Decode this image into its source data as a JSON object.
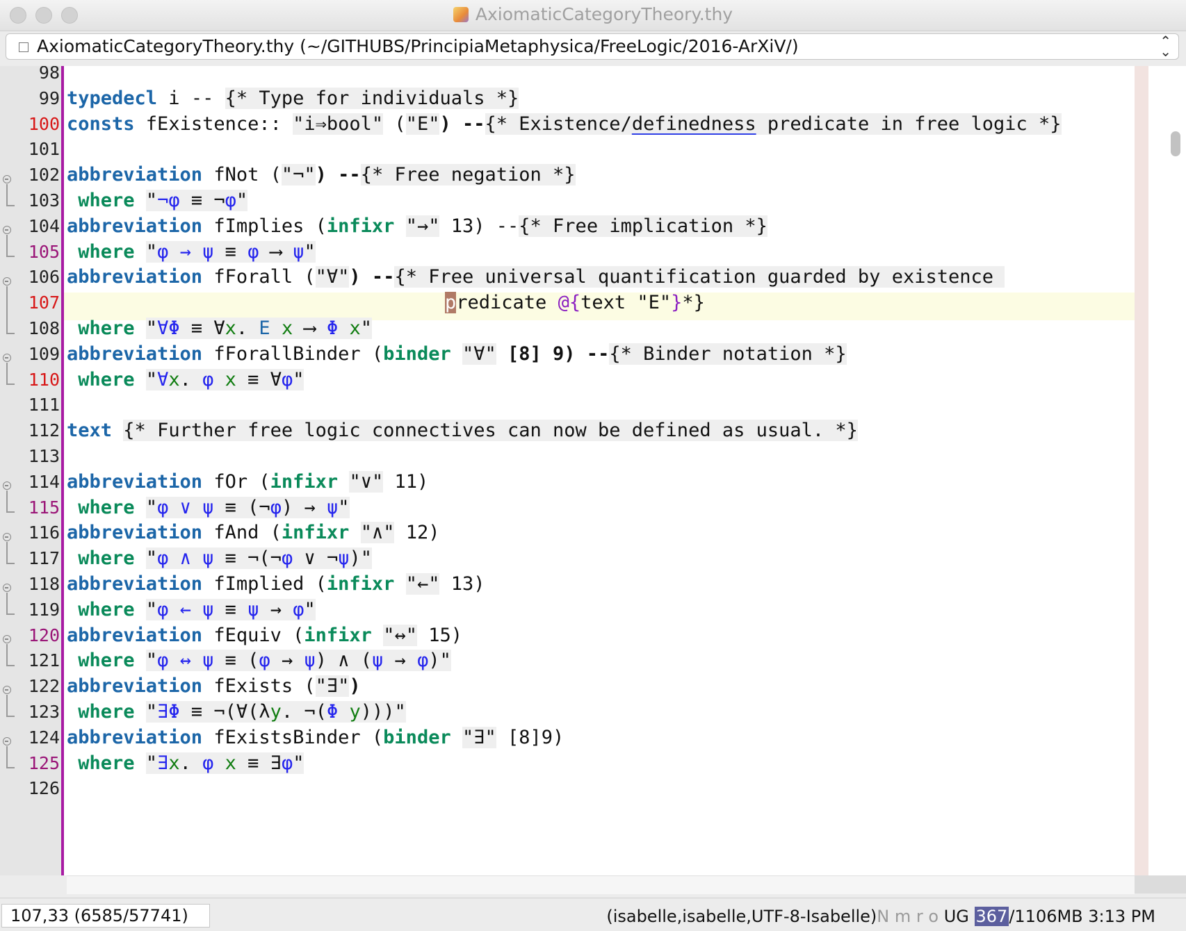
{
  "window": {
    "title": "AxiomaticCategoryTheory.thy"
  },
  "path_bar": {
    "text": "AxiomaticCategoryTheory.thy (~/GITHUBS/PrincipiaMetaphysica/FreeLogic/2016-ArXiV/)"
  },
  "line_numbers": [
    "98",
    "99",
    "100",
    "101",
    "102",
    "103",
    "104",
    "105",
    "106",
    "107",
    "108",
    "109",
    "110",
    "111",
    "112",
    "113",
    "114",
    "115",
    "116",
    "117",
    "118",
    "119",
    "120",
    "121",
    "122",
    "123",
    "124",
    "125",
    "126"
  ],
  "code": {
    "l98": [],
    "l99": [
      "typedecl",
      " i -- ",
      "{* Type for individuals *}"
    ],
    "l100": [
      "consts",
      " fExistence:: ",
      "\"i⇒bool\"",
      " (",
      "\"E\"",
      ") --",
      "{* Existence/",
      "definedness",
      " predicate in free logic *}"
    ],
    "l101": [],
    "l102": [
      "abbreviation",
      " fNot (",
      "\"¬\"",
      ") --",
      "{* Free negation *}"
    ],
    "l103": [
      " ",
      "where",
      " ",
      "\"",
      "¬",
      "φ",
      " ≡ ¬",
      "φ",
      "\""
    ],
    "l104": [
      "abbreviation",
      " fImplies (",
      "infixr",
      " ",
      "\"→\"",
      " 13) --",
      "{* Free implication *}"
    ],
    "l105": [
      " ",
      "where",
      " ",
      "\"",
      "φ",
      " ",
      "→",
      " ",
      "ψ",
      " ≡ ",
      "φ",
      " ⟶ ",
      "ψ",
      "\""
    ],
    "l106": [
      "abbreviation",
      " fForall (",
      "\"∀\"",
      ") --",
      "{* Free universal quantification guarded by existence "
    ],
    "l107": [
      "p",
      "redicate ",
      "@{",
      "text ",
      "\"E\"",
      "}",
      "*}"
    ],
    "l108": [
      " ",
      "where",
      " ",
      "\"",
      "∀",
      "Φ",
      " ≡ ∀",
      "x",
      ". ",
      "E",
      " ",
      "x",
      " ⟶ ",
      "Φ",
      " ",
      "x",
      "\""
    ],
    "l109": [
      "abbreviation",
      " fForallBinder (",
      "binder",
      " ",
      "\"∀\"",
      " [8] 9) --",
      "{* Binder notation *}"
    ],
    "l110": [
      " ",
      "where",
      " ",
      "\"",
      "∀",
      "x",
      ". ",
      "φ",
      " ",
      "x",
      " ≡ ∀",
      "φ",
      "\""
    ],
    "l111": [],
    "l112": [
      "text",
      " ",
      "{* Further free logic connectives can now be defined as usual. *}"
    ],
    "l113": [],
    "l114": [
      "abbreviation",
      " fOr (",
      "infixr",
      " ",
      "\"∨\"",
      " 11)"
    ],
    "l115": [
      " ",
      "where",
      " ",
      "\"",
      "φ",
      " ",
      "∨",
      " ",
      "ψ",
      " ≡ (¬",
      "φ",
      ") → ",
      "ψ",
      "\""
    ],
    "l116": [
      "abbreviation",
      " fAnd (",
      "infixr",
      " ",
      "\"∧\"",
      " 12)"
    ],
    "l117": [
      " ",
      "where",
      " ",
      "\"",
      "φ",
      " ",
      "∧",
      " ",
      "ψ",
      " ≡ ¬(¬",
      "φ",
      " ∨ ¬",
      "ψ",
      ")\""
    ],
    "l118": [
      "abbreviation",
      " fImplied (",
      "infixr",
      " ",
      "\"←\"",
      " 13)"
    ],
    "l119": [
      " ",
      "where",
      " ",
      "\"",
      "φ",
      " ",
      "←",
      " ",
      "ψ",
      " ≡ ",
      "ψ",
      " → ",
      "φ",
      "\""
    ],
    "l120": [
      "abbreviation",
      " fEquiv (",
      "infixr",
      " ",
      "\"↔\"",
      " 15)"
    ],
    "l121": [
      " ",
      "where",
      " ",
      "\"",
      "φ",
      " ",
      "↔",
      " ",
      "ψ",
      " ≡ (",
      "φ",
      " → ",
      "ψ",
      ") ∧ (",
      "ψ",
      " → ",
      "φ",
      ")\""
    ],
    "l122": [
      "abbreviation",
      " fExists (",
      "\"∃\"",
      ")"
    ],
    "l123": [
      " ",
      "where",
      " ",
      "\"",
      "∃",
      "Φ",
      " ≡ ¬(∀(λ",
      "y",
      ". ¬(",
      "Φ",
      " ",
      "y",
      ")))\""
    ],
    "l124": [
      "abbreviation",
      " fExistsBinder (",
      "binder",
      " ",
      "\"∃\"",
      " [8]9)"
    ],
    "l125": [
      " ",
      "where",
      " ",
      "\"",
      "∃",
      "x",
      ". ",
      "φ",
      " ",
      "x",
      " ≡ ∃",
      "φ",
      "\""
    ],
    "l126": []
  },
  "status_bar": {
    "position": "107,33 (6585/57741)",
    "mode": "(isabelle,isabelle,UTF-8-Isabelle)",
    "flags": "N m r o",
    "ug": " UG ",
    "mem_used": "367",
    "mem_total": "/1106MB",
    "time": " 3:13 PM"
  }
}
